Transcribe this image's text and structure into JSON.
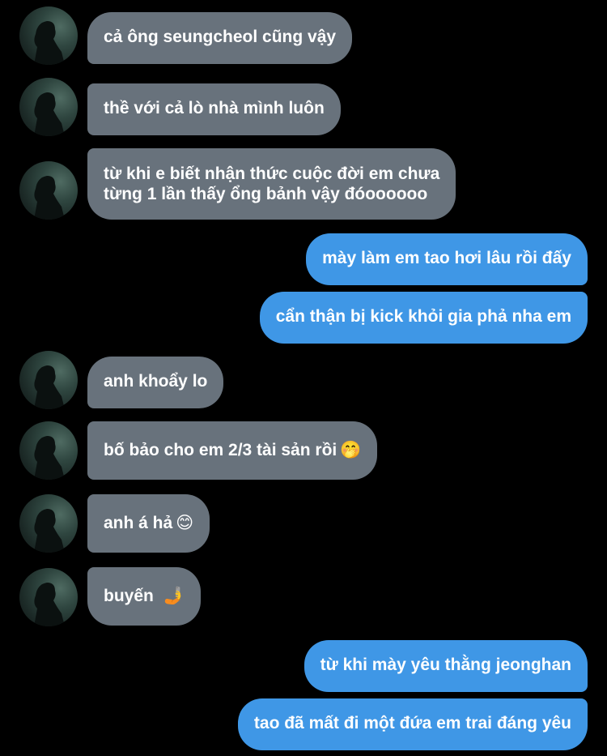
{
  "messages": [
    {
      "side": "in",
      "text": [
        "cả ông seungcheol cũng vậy"
      ]
    },
    {
      "side": "in",
      "text": [
        "thề với cả lò nhà mình luôn"
      ]
    },
    {
      "side": "in",
      "text": [
        "từ khi e biết nhận thức cuộc đời em chưa",
        "từng 1 lần thấy ổng bảnh vậy đóoooooo"
      ]
    },
    {
      "side": "out",
      "text": [
        "mày làm em tao hơi lâu rồi đấy"
      ]
    },
    {
      "side": "out",
      "text": [
        "cẩn thận bị kick khỏi gia phả nha em"
      ]
    },
    {
      "side": "in",
      "text": [
        "anh khoẩy lo"
      ]
    },
    {
      "side": "in",
      "text": [
        "bố bảo cho em 2/3 tài sản rồi"
      ],
      "emoji": "🤭",
      "emoji_name": "face-with-hand-over-mouth-icon"
    },
    {
      "side": "in",
      "text": [
        "anh á hả"
      ],
      "emoji": "😊",
      "emoji_name": "smiling-face-icon"
    },
    {
      "side": "in",
      "text": [
        "buyến"
      ],
      "emoji": "🤳",
      "emoji_name": "selfie-icon"
    },
    {
      "side": "out",
      "text": [
        "từ khi mày yêu thằng jeonghan"
      ]
    },
    {
      "side": "out",
      "text": [
        "tao đã mất đi một đứa em trai đáng yêu"
      ]
    }
  ],
  "colors": {
    "background": "#000000",
    "incoming_bubble": "#68727c",
    "outgoing_bubble": "#3f97e6",
    "text": "#ffffff"
  }
}
